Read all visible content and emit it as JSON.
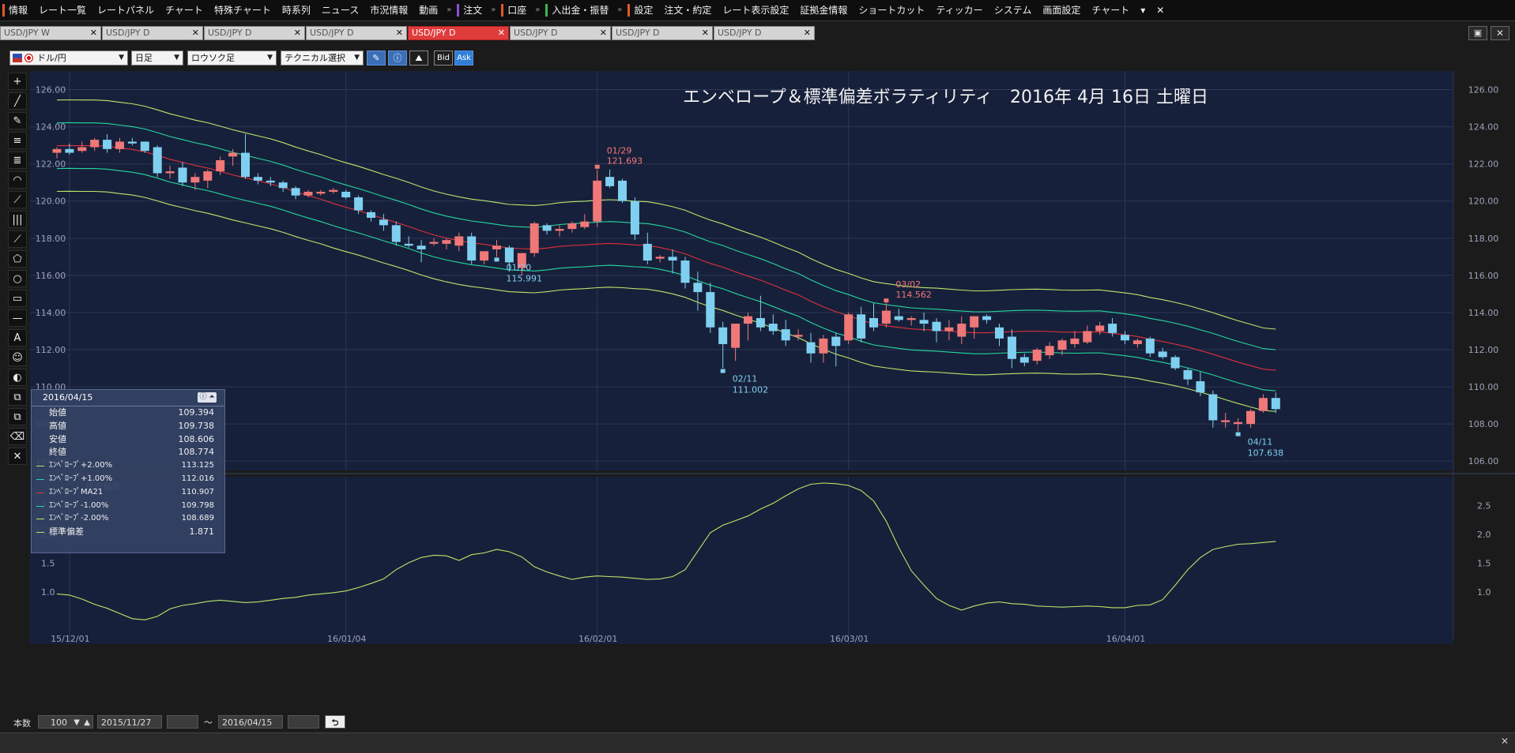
{
  "menubar": {
    "items": [
      {
        "label": "情報",
        "accent": "#e05a2a"
      },
      {
        "label": "レート一覧"
      },
      {
        "label": "レートパネル"
      },
      {
        "label": "チャート"
      },
      {
        "label": "特殊チャート"
      },
      {
        "label": "時系列"
      },
      {
        "label": "ニュース"
      },
      {
        "label": "市況情報"
      },
      {
        "label": "動画"
      },
      {
        "sep": "»"
      },
      {
        "label": "注文",
        "accent": "#8a4fd8"
      },
      {
        "sep": "»"
      },
      {
        "label": "口座",
        "accent": "#e05a2a"
      },
      {
        "sep": "»"
      },
      {
        "label": "入出金・振替",
        "accent": "#3ab84a"
      },
      {
        "sep": "»"
      },
      {
        "label": "設定",
        "accent": "#e05a2a"
      },
      {
        "label": "注文・約定"
      },
      {
        "label": "レート表示設定"
      },
      {
        "label": "証拠金情報"
      },
      {
        "label": "ショートカット"
      },
      {
        "label": "ティッカー"
      },
      {
        "label": "システム"
      },
      {
        "label": "画面設定"
      },
      {
        "label": "チャート"
      },
      {
        "label": "▾"
      },
      {
        "label": "✕"
      }
    ]
  },
  "tabs": [
    {
      "label": "USD/JPY W",
      "active": false
    },
    {
      "label": "USD/JPY D",
      "active": false
    },
    {
      "label": "USD/JPY D",
      "active": false
    },
    {
      "label": "USD/JPY D",
      "active": false
    },
    {
      "label": "USD/JPY D",
      "active": true
    },
    {
      "label": "USD/JPY D",
      "active": false
    },
    {
      "label": "USD/JPY D",
      "active": false
    },
    {
      "label": "USD/JPY D",
      "active": false
    }
  ],
  "toolbar": {
    "pair": "ドル/円",
    "timeframe": "日足",
    "charttype": "ロウソク足",
    "technical": "テクニカル選択",
    "bid": "Bid",
    "ask": "Ask"
  },
  "lefttools": [
    "crosshair-icon",
    "line-icon",
    "ruler-icon",
    "hlines-icon",
    "channel-icon",
    "fib-arc-icon",
    "fib-fan-icon",
    "vlines-icon",
    "pitchfork-icon",
    "pentagon-icon",
    "circle-icon",
    "rect-icon",
    "hline-icon",
    "text-icon",
    "icon-icon",
    "pointer-icon",
    "copy-icon",
    "paste-icon",
    "eraser-icon",
    "clear-icon"
  ],
  "lefttool_glyphs": [
    "+",
    "╱",
    "✎",
    "≡",
    "≣",
    "◠",
    "⟋",
    "|||",
    "⟋",
    "⬠",
    "○",
    "▭",
    "—",
    "A",
    "☺",
    "◐",
    "⧉",
    "⧉",
    "⌫",
    "✕"
  ],
  "chart_title": "エンベロープ＆標準偏差ボラティリティ　2016年 4月 16日 土曜日",
  "info": {
    "date": "2016/04/15",
    "rows": [
      {
        "label": "始値",
        "value": "109.394"
      },
      {
        "label": "高値",
        "value": "109.738"
      },
      {
        "label": "安値",
        "value": "108.606"
      },
      {
        "label": "終値",
        "value": "108.774"
      },
      {
        "label": "ｴﾝﾍﾞﾛｰﾌﾟ+2.00%",
        "value": "113.125",
        "color": "#b8e86a"
      },
      {
        "label": "ｴﾝﾍﾞﾛｰﾌﾟ+1.00%",
        "value": "112.016",
        "color": "#23d8a0"
      },
      {
        "label": "ｴﾝﾍﾞﾛｰﾌﾟMA21",
        "value": "110.907",
        "color": "#e0303a"
      },
      {
        "label": "ｴﾝﾍﾞﾛｰﾌﾟ-1.00%",
        "value": "109.798",
        "color": "#23d8a0"
      },
      {
        "label": "ｴﾝﾍﾞﾛｰﾌﾟ-2.00%",
        "value": "108.689",
        "color": "#b8e86a"
      },
      {
        "label": "標準偏差",
        "value": "1.871",
        "color": "#b8e86a"
      }
    ]
  },
  "bottombar": {
    "count_label": "本数",
    "count": "100",
    "from": "2015/11/27",
    "tilde": "～",
    "to": "2016/04/15"
  },
  "chart_data": [
    {
      "type": "candlestick",
      "title": "エンベロープ＆標準偏差ボラティリティ　2016年 4月 16日 土曜日",
      "ylim": [
        105.5,
        127.0
      ],
      "yticks": [
        "126.00",
        "124.00",
        "122.00",
        "120.00",
        "118.00",
        "116.00",
        "114.00",
        "112.00",
        "110.00",
        "108.00",
        "106.00"
      ],
      "xlabels": [
        {
          "i": 1,
          "label": "15/12/01"
        },
        {
          "i": 23,
          "label": "16/01/04"
        },
        {
          "i": 43,
          "label": "16/02/01"
        },
        {
          "i": 63,
          "label": "16/03/01"
        },
        {
          "i": 85,
          "label": "16/04/01"
        }
      ],
      "up_color": "#f07878",
      "down_color": "#7fd0f0",
      "candles": [
        [
          122.6,
          122.9,
          122.3,
          122.8
        ],
        [
          122.8,
          123.1,
          122.5,
          122.6
        ],
        [
          122.7,
          123.2,
          122.6,
          122.9
        ],
        [
          122.9,
          123.4,
          122.7,
          123.3
        ],
        [
          123.3,
          123.6,
          122.6,
          122.8
        ],
        [
          122.8,
          123.4,
          122.6,
          123.2
        ],
        [
          123.2,
          123.4,
          123.0,
          123.1
        ],
        [
          123.2,
          123.2,
          122.6,
          122.7
        ],
        [
          122.9,
          123.0,
          121.3,
          121.5
        ],
        [
          121.5,
          121.9,
          121.2,
          121.6
        ],
        [
          121.8,
          122.1,
          120.8,
          121.0
        ],
        [
          121.0,
          121.5,
          120.6,
          121.3
        ],
        [
          121.1,
          121.7,
          120.7,
          121.6
        ],
        [
          121.6,
          122.4,
          121.4,
          122.2
        ],
        [
          122.4,
          122.8,
          121.9,
          122.6
        ],
        [
          122.6,
          123.6,
          121.2,
          121.3
        ],
        [
          121.3,
          121.5,
          120.9,
          121.1
        ],
        [
          121.1,
          121.3,
          120.8,
          121.0
        ],
        [
          121.0,
          121.1,
          120.5,
          120.7
        ],
        [
          120.7,
          120.8,
          120.1,
          120.3
        ],
        [
          120.3,
          120.6,
          120.2,
          120.5
        ],
        [
          120.4,
          120.6,
          120.3,
          120.5
        ],
        [
          120.5,
          120.7,
          120.4,
          120.6
        ],
        [
          120.5,
          120.6,
          120.1,
          120.2
        ],
        [
          120.2,
          120.3,
          119.3,
          119.5
        ],
        [
          119.4,
          119.5,
          118.9,
          119.1
        ],
        [
          119.0,
          119.3,
          118.4,
          118.7
        ],
        [
          118.7,
          118.9,
          117.6,
          117.8
        ],
        [
          117.7,
          118.1,
          117.5,
          117.6
        ],
        [
          117.6,
          117.9,
          116.7,
          117.4
        ],
        [
          117.7,
          118.0,
          117.6,
          117.8
        ],
        [
          117.7,
          118.0,
          117.4,
          117.9
        ],
        [
          117.6,
          118.3,
          117.3,
          118.1
        ],
        [
          118.1,
          118.3,
          116.6,
          116.8
        ],
        [
          116.8,
          117.2,
          116.6,
          117.3
        ],
        [
          117.4,
          117.9,
          117.0,
          117.6
        ],
        [
          117.5,
          117.6,
          116.2,
          116.7
        ],
        [
          116.4,
          117.2,
          116.0,
          117.2
        ],
        [
          117.2,
          118.9,
          117.0,
          118.8
        ],
        [
          118.7,
          118.8,
          118.2,
          118.4
        ],
        [
          118.4,
          118.7,
          118.1,
          118.5
        ],
        [
          118.5,
          118.9,
          118.3,
          118.8
        ],
        [
          118.6,
          119.3,
          118.5,
          118.9
        ],
        [
          118.9,
          121.7,
          118.6,
          121.1
        ],
        [
          121.3,
          121.7,
          120.7,
          120.8
        ],
        [
          121.1,
          121.2,
          119.9,
          120.0
        ],
        [
          120.0,
          120.2,
          117.9,
          118.2
        ],
        [
          117.7,
          118.3,
          116.6,
          116.8
        ],
        [
          116.9,
          117.1,
          116.7,
          117.0
        ],
        [
          117.0,
          117.4,
          116.1,
          116.8
        ],
        [
          116.8,
          117.0,
          115.3,
          115.6
        ],
        [
          115.6,
          116.2,
          114.1,
          115.1
        ],
        [
          115.1,
          115.6,
          112.9,
          113.2
        ],
        [
          113.2,
          113.5,
          111.0,
          112.3
        ],
        [
          112.1,
          113.4,
          111.4,
          113.4
        ],
        [
          113.4,
          114.0,
          112.5,
          113.8
        ],
        [
          113.7,
          114.9,
          113.0,
          113.2
        ],
        [
          113.4,
          113.9,
          112.8,
          113.0
        ],
        [
          113.1,
          113.6,
          112.2,
          112.5
        ],
        [
          112.7,
          113.1,
          112.5,
          112.8
        ],
        [
          112.4,
          112.9,
          111.3,
          111.8
        ],
        [
          111.8,
          112.8,
          111.3,
          112.6
        ],
        [
          112.7,
          112.9,
          111.1,
          112.2
        ],
        [
          112.5,
          114.0,
          112.3,
          113.9
        ],
        [
          113.9,
          114.3,
          112.4,
          112.6
        ],
        [
          113.7,
          114.5,
          113.0,
          113.2
        ],
        [
          113.4,
          114.5,
          113.2,
          114.1
        ],
        [
          113.8,
          114.2,
          113.5,
          113.6
        ],
        [
          113.6,
          113.8,
          113.3,
          113.7
        ],
        [
          113.6,
          114.0,
          113.0,
          113.4
        ],
        [
          113.5,
          113.7,
          112.4,
          113.0
        ],
        [
          113.0,
          113.6,
          112.5,
          113.2
        ],
        [
          112.7,
          113.8,
          112.3,
          113.4
        ],
        [
          113.2,
          113.8,
          112.6,
          113.8
        ],
        [
          113.8,
          113.9,
          113.4,
          113.6
        ],
        [
          113.2,
          113.4,
          112.2,
          112.6
        ],
        [
          112.7,
          113.1,
          111.0,
          111.5
        ],
        [
          111.6,
          111.8,
          111.1,
          111.3
        ],
        [
          111.4,
          112.1,
          111.2,
          112.0
        ],
        [
          111.7,
          112.4,
          111.5,
          112.2
        ],
        [
          112.0,
          112.6,
          111.7,
          112.5
        ],
        [
          112.3,
          113.0,
          112.1,
          112.6
        ],
        [
          112.4,
          113.3,
          112.3,
          113.0
        ],
        [
          113.0,
          113.5,
          112.8,
          113.3
        ],
        [
          113.4,
          113.7,
          112.7,
          112.9
        ],
        [
          112.8,
          113.0,
          112.3,
          112.5
        ],
        [
          112.3,
          112.6,
          112.1,
          112.5
        ],
        [
          112.6,
          112.7,
          111.6,
          111.8
        ],
        [
          111.9,
          112.1,
          111.5,
          111.6
        ],
        [
          111.6,
          111.7,
          110.9,
          111.0
        ],
        [
          110.9,
          111.0,
          110.1,
          110.4
        ],
        [
          110.3,
          110.8,
          109.5,
          109.7
        ],
        [
          109.6,
          109.8,
          107.8,
          108.2
        ],
        [
          108.1,
          108.6,
          107.8,
          108.2
        ],
        [
          108.0,
          108.3,
          107.6,
          108.1
        ],
        [
          108.0,
          108.8,
          107.8,
          108.7
        ],
        [
          108.7,
          109.6,
          108.6,
          109.4
        ],
        [
          109.4,
          109.7,
          108.6,
          108.8
        ]
      ],
      "annotations": [
        {
          "i": 43,
          "date": "01/29",
          "value": "121.693",
          "pos": "above",
          "color": "#f07878"
        },
        {
          "i": 35,
          "date": "01/20",
          "value": "115.991",
          "pos": "below",
          "color": "#7fd0f0"
        },
        {
          "i": 53,
          "date": "02/11",
          "value": "111.002",
          "pos": "below",
          "color": "#7fd0f0"
        },
        {
          "i": 66,
          "date": "03/02",
          "value": "114.562",
          "pos": "above",
          "color": "#f07878"
        },
        {
          "i": 94,
          "date": "04/11",
          "value": "107.638",
          "pos": "below",
          "color": "#7fd0f0"
        }
      ],
      "envelope": {
        "ma21": [
          122.98,
          122.99,
          122.98,
          122.98,
          122.95,
          122.86,
          122.78,
          122.65,
          122.46,
          122.25,
          122.09,
          121.92,
          121.78,
          121.6,
          121.41,
          121.25,
          121.09,
          120.93,
          120.73,
          120.5,
          120.29,
          120.1,
          119.87,
          119.67,
          119.48,
          119.27,
          119.05,
          118.85,
          118.63,
          118.39,
          118.18,
          118.01,
          117.87,
          117.75,
          117.67,
          117.57,
          117.47,
          117.44,
          117.41,
          117.47,
          117.56,
          117.61,
          117.64,
          117.69,
          117.72,
          117.69,
          117.64,
          117.61,
          117.5,
          117.35,
          117.16,
          116.89,
          116.64,
          116.44,
          116.19,
          115.96,
          115.74,
          115.48,
          115.2,
          114.95,
          114.61,
          114.31,
          114.04,
          113.83,
          113.59,
          113.39,
          113.29,
          113.2,
          113.12,
          113.08,
          113.05,
          113.0,
          112.95,
          112.91,
          112.91,
          112.94,
          112.97,
          112.99,
          113.0,
          112.98,
          112.95,
          112.94,
          112.95,
          112.96,
          112.88,
          112.8,
          112.71,
          112.56,
          112.44,
          112.3,
          112.14,
          111.95,
          111.76,
          111.54,
          111.33,
          111.14,
          110.95,
          110.89
        ]
      }
    },
    {
      "type": "line",
      "title": "標準偏差",
      "ylim": [
        0.1,
        3.0
      ],
      "yticks": [
        "2.5",
        "2.0",
        "1.5",
        "1.0"
      ],
      "values": [
        0.97,
        0.95,
        0.88,
        0.79,
        0.72,
        0.63,
        0.54,
        0.52,
        0.58,
        0.71,
        0.77,
        0.8,
        0.84,
        0.86,
        0.84,
        0.82,
        0.83,
        0.86,
        0.89,
        0.91,
        0.95,
        0.97,
        0.99,
        1.02,
        1.08,
        1.15,
        1.23,
        1.39,
        1.51,
        1.6,
        1.64,
        1.63,
        1.55,
        1.65,
        1.68,
        1.74,
        1.7,
        1.61,
        1.44,
        1.35,
        1.28,
        1.22,
        1.26,
        1.28,
        1.27,
        1.26,
        1.24,
        1.22,
        1.23,
        1.27,
        1.39,
        1.71,
        2.03,
        2.16,
        2.24,
        2.32,
        2.44,
        2.54,
        2.67,
        2.79,
        2.87,
        2.89,
        2.88,
        2.85,
        2.76,
        2.58,
        2.23,
        1.77,
        1.37,
        1.12,
        0.89,
        0.77,
        0.69,
        0.76,
        0.81,
        0.83,
        0.8,
        0.79,
        0.76,
        0.75,
        0.74,
        0.75,
        0.76,
        0.75,
        0.73,
        0.73,
        0.77,
        0.78,
        0.87,
        1.12,
        1.39,
        1.6,
        1.74,
        1.79,
        1.83,
        1.84,
        1.86,
        1.88
      ]
    }
  ]
}
